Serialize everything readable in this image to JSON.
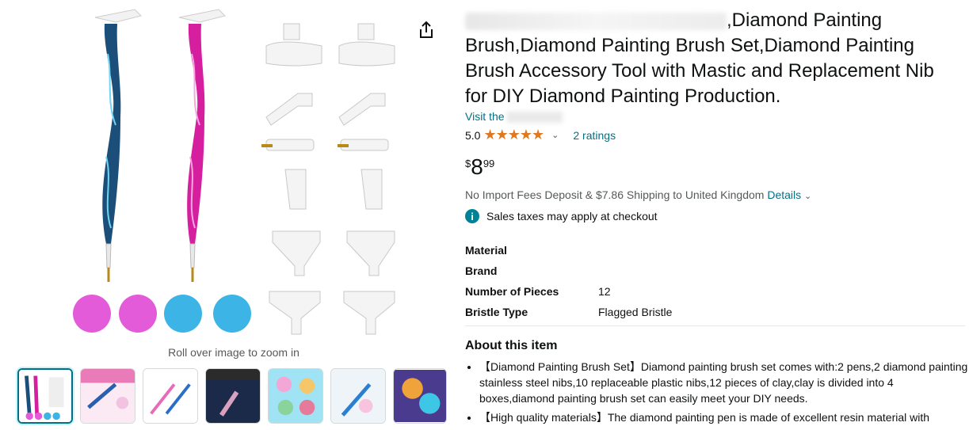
{
  "gallery": {
    "zoom_hint": "Roll over image to zoom in",
    "swatch_colors": [
      "#e35bd8",
      "#e35bd8",
      "#3cb4e6",
      "#3cb4e6"
    ],
    "thumbnails": [
      "thumb-1",
      "thumb-2",
      "thumb-3",
      "thumb-4",
      "thumb-5",
      "thumb-6",
      "thumb-7"
    ],
    "active_thumbnail": 1
  },
  "product": {
    "title_tail": ",Diamond Painting Brush,Diamond Painting Brush Set,Diamond Painting Brush Accessory Tool with Mastic and Replacement Nib for DIY Diamond Painting Production.",
    "visit_store": "Visit the",
    "rating_value": "5.0",
    "stars": "★★★★★",
    "ratings_count": "2 ratings",
    "price_symbol": "$",
    "price_whole": "8",
    "price_fraction": "99",
    "shipping_text": "No Import Fees Deposit & $7.86 Shipping to United Kingdom",
    "shipping_details": "Details",
    "tax_note": "Sales taxes may apply at checkout"
  },
  "specs": [
    {
      "key": "Material",
      "value": ""
    },
    {
      "key": "Brand",
      "value": ""
    },
    {
      "key": "Number of Pieces",
      "value": "12"
    },
    {
      "key": "Bristle Type",
      "value": "Flagged Bristle"
    }
  ],
  "about": {
    "heading": "About this item",
    "bullets": [
      "【Diamond Painting Brush Set】Diamond painting brush set comes with:2 pens,2 diamond painting stainless steel nibs,10 replaceable plastic nibs,12 pieces of clay,clay is divided into 4 boxes,diamond painting brush set can easily meet your DIY needs.",
      "【High quality materials】The diamond painting pen is made of excellent resin material with"
    ]
  },
  "colors": {
    "link": "#007185",
    "star": "#de7921",
    "pen_blue": "#1c4f7a",
    "pen_pink": "#d61f9e"
  }
}
